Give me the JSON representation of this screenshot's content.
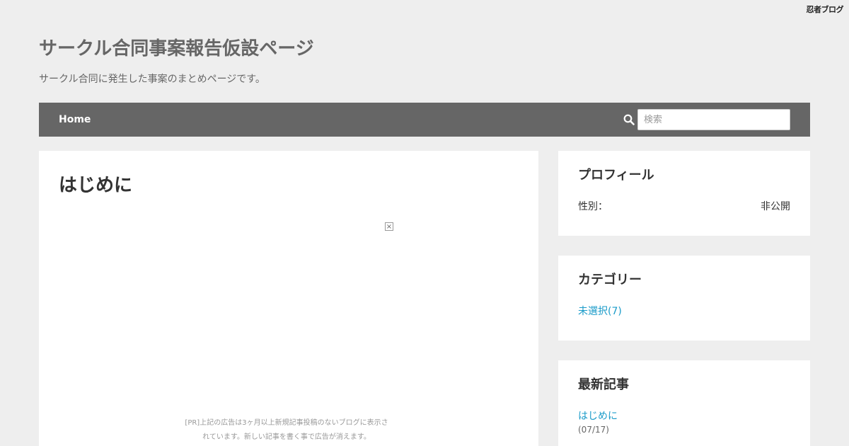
{
  "brand": {
    "logo_text": "忍者ブログ"
  },
  "site": {
    "title": "サークル合同事案報告仮設ページ",
    "description": "サークル合同に発生した事案のまとめページです。"
  },
  "nav": {
    "home_label": "Home",
    "search_placeholder": "検索"
  },
  "article": {
    "title": "はじめに",
    "ad_close": "×",
    "ad_notice_line1": "[PR]上記の広告は3ヶ月以上新規記事投稿のないブログに表示さ",
    "ad_notice_line2": "れています。新しい記事を書く事で広告が消えます。"
  },
  "sidebar": {
    "profile": {
      "title": "プロフィール",
      "gender_label": "性別：",
      "gender_value": "非公開"
    },
    "category": {
      "title": "カテゴリー",
      "items": [
        {
          "label": "未選択(7)"
        }
      ]
    },
    "recent": {
      "title": "最新記事",
      "items": [
        {
          "label": "はじめに",
          "date": "(07/17)"
        },
        {
          "label": "",
          "date": ""
        }
      ]
    }
  },
  "colors": {
    "background": "#eeeeee",
    "navbar": "#666666",
    "link": "#1a9bc9"
  }
}
